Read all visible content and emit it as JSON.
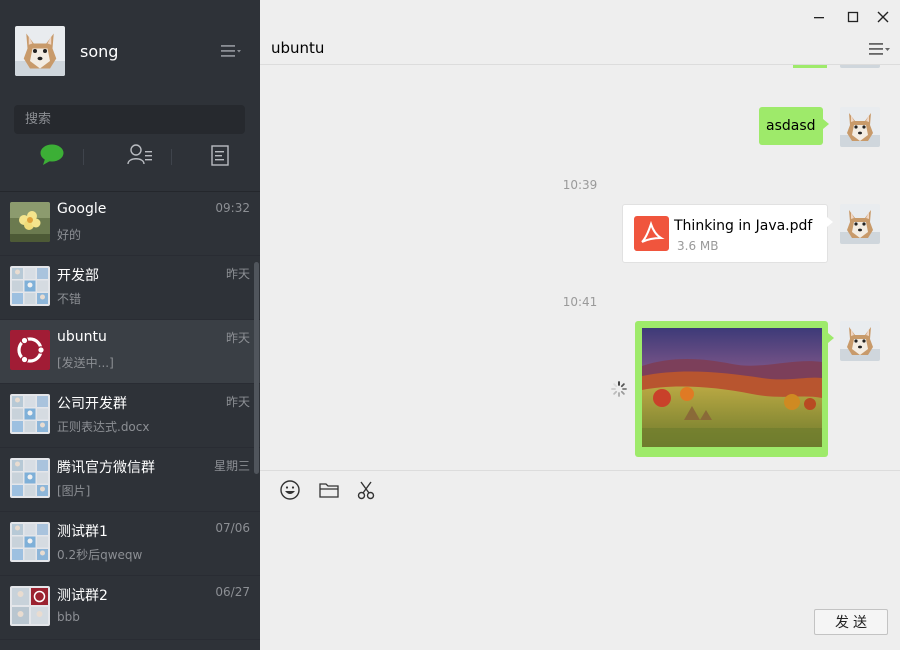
{
  "colors": {
    "sidebar_bg": "#2e3238",
    "active_item": "#3a3f45",
    "bubble": "#9eea6a",
    "accent_green": "#3caf36",
    "pdf_red": "#f0553d",
    "main_bg": "#eeeeee"
  },
  "profile": {
    "username": "song",
    "avatar_icon": "dog-avatar-icon",
    "menu_icon": "hamburger-menu-icon"
  },
  "search": {
    "placeholder": "搜索"
  },
  "sidebar_tabs": [
    {
      "name": "chats",
      "icon": "chat-bubble-icon",
      "active": true
    },
    {
      "name": "contacts",
      "icon": "contacts-icon",
      "active": false
    },
    {
      "name": "favorites",
      "icon": "document-icon",
      "active": false
    }
  ],
  "chats": [
    {
      "name": "Google",
      "time": "09:32",
      "preview": "好的",
      "avatar": "flower-avatar"
    },
    {
      "name": "开发部",
      "time": "昨天",
      "preview": "不错",
      "avatar": "group-avatar"
    },
    {
      "name": "ubuntu",
      "time": "昨天",
      "preview": "[发送中...]",
      "avatar": "ubuntu-avatar",
      "active": true
    },
    {
      "name": "公司开发群",
      "time": "昨天",
      "preview": "正则表达式.docx",
      "avatar": "group-avatar"
    },
    {
      "name": "腾讯官方微信群",
      "time": "星期三",
      "preview": "[图片]",
      "avatar": "group-avatar"
    },
    {
      "name": "测试群1",
      "time": "07/06",
      "preview": "0.2秒后qweqw",
      "avatar": "group-avatar"
    },
    {
      "name": "测试群2",
      "time": "06/27",
      "preview": "bbb",
      "avatar": "group-avatar"
    }
  ],
  "chat": {
    "title": "ubuntu",
    "messages": [
      {
        "type": "text",
        "text": "asdasd",
        "from": "me"
      },
      {
        "type": "time",
        "text": "10:39"
      },
      {
        "type": "file",
        "file_name": "Thinking in Java.pdf",
        "file_size": "3.6 MB",
        "icon": "pdf-icon",
        "from": "me"
      },
      {
        "type": "time",
        "text": "10:41"
      },
      {
        "type": "image",
        "description_icon": "landscape-image",
        "status": "sending",
        "from": "me"
      }
    ]
  },
  "composer": {
    "tools": [
      "emoji-icon",
      "folder-icon",
      "scissors-icon"
    ],
    "send_label": "发送"
  },
  "window_controls": [
    "minimize-icon",
    "maximize-icon",
    "close-icon"
  ]
}
